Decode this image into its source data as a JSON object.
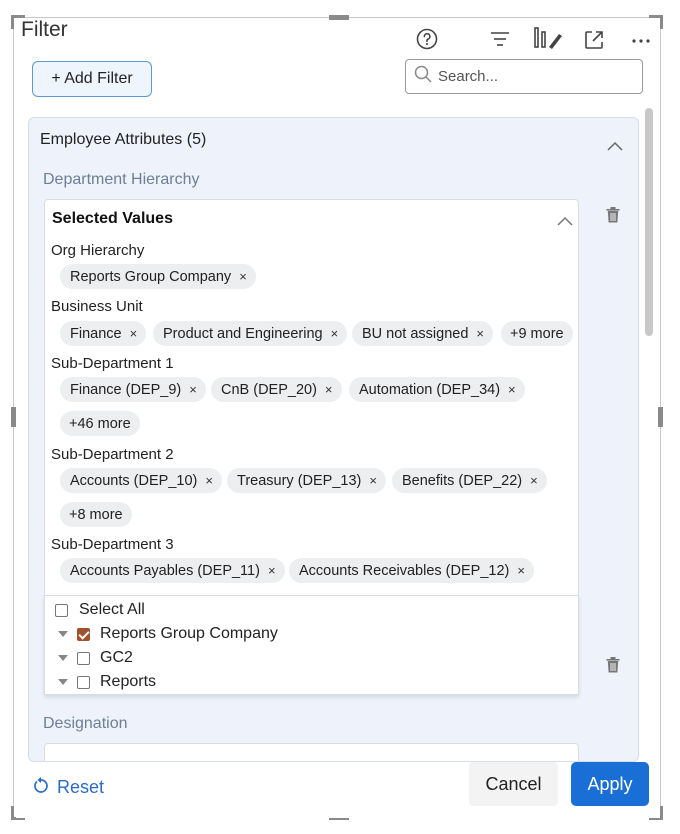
{
  "panel": {
    "title": "Filter",
    "add_filter_label": "+ Add Filter",
    "search_placeholder": "Search...",
    "toolbar_icons": [
      "help-icon",
      "filter-lines-icon",
      "format-brush-icon",
      "expand-icon",
      "more-icon"
    ]
  },
  "section": {
    "title": "Employee Attributes (5)",
    "department_label": "Department Hierarchy",
    "selected_values_title": "Selected Values",
    "categories": [
      {
        "name": "Org Hierarchy",
        "chips": [
          "Reports Group Company"
        ],
        "more": ""
      },
      {
        "name": "Business Unit",
        "chips": [
          "Finance",
          "Product and Engineering",
          "BU not assigned"
        ],
        "more": "+9 more"
      },
      {
        "name": "Sub-Department 1",
        "chips": [
          "Finance (DEP_9)",
          "CnB (DEP_20)",
          "Automation (DEP_34)"
        ],
        "more": "+46 more"
      },
      {
        "name": "Sub-Department 2",
        "chips": [
          "Accounts (DEP_10)",
          "Treasury (DEP_13)",
          "Benefits (DEP_22)"
        ],
        "more": "+8 more"
      },
      {
        "name": "Sub-Department 3",
        "chips": [
          "Accounts Payables (DEP_11)",
          "Accounts Receivables (DEP_12)"
        ],
        "more": ""
      }
    ],
    "chip_remove_glyph": "×",
    "dropdown": {
      "select_all": "Select All",
      "items": [
        {
          "label": "Reports Group Company",
          "checked": true
        },
        {
          "label": "GC2",
          "checked": false
        },
        {
          "label": "Reports",
          "checked": false
        }
      ]
    },
    "designation_label": "Designation"
  },
  "footer": {
    "reset_label": "Reset",
    "cancel_label": "Cancel",
    "apply_label": "Apply"
  },
  "colors": {
    "accent": "#1a6fd6",
    "link": "#2b6cc4",
    "checkbox_checked": "#a0512d",
    "section_bg": "#eef3fb"
  }
}
